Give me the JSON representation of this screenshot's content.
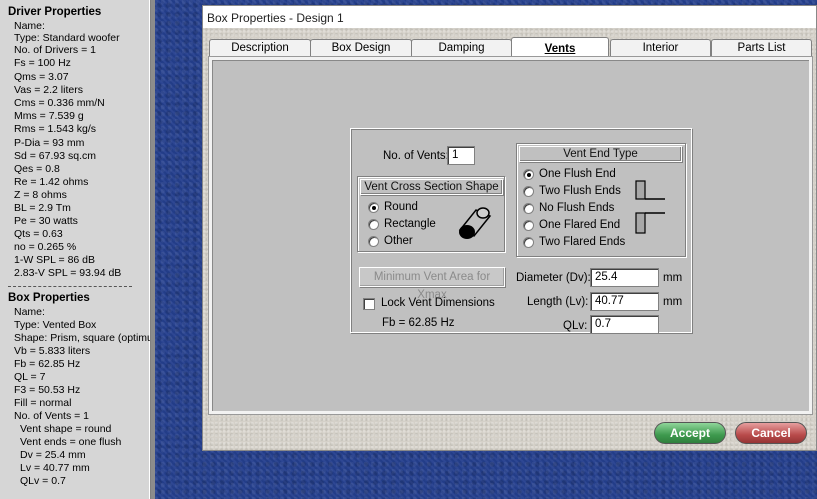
{
  "driver": {
    "title": "Driver Properties",
    "lines": [
      "Name:",
      "Type: Standard woofer",
      "No. of Drivers = 1",
      "Fs = 100 Hz",
      "Qms = 3.07",
      "Vas = 2.2 liters",
      "Cms = 0.336 mm/N",
      "Mms = 7.539 g",
      "Rms = 1.543 kg/s",
      "P-Dia = 93 mm",
      "Sd = 67.93 sq.cm",
      "Qes = 0.8",
      "Re = 1.42 ohms",
      "Z = 8 ohms",
      "BL = 2.9 Tm",
      "Pe = 30 watts",
      "Qts = 0.63",
      "no = 0.265 %",
      "1-W SPL = 86 dB",
      "2.83-V SPL = 93.94 dB"
    ]
  },
  "box": {
    "title": "Box Properties",
    "lines": [
      "Name:",
      "Type: Vented Box",
      "Shape: Prism, square (optimum)",
      "Vb = 5.833 liters",
      "Fb = 62.85 Hz",
      "QL = 7",
      "F3 = 50.53 Hz",
      "Fill = normal",
      "No. of Vents = 1"
    ],
    "sub_lines": [
      "Vent shape = round",
      "Vent ends = one flush",
      "Dv = 25.4 mm",
      "Lv = 40.77 mm",
      "QLv = 0.7"
    ]
  },
  "dialog": {
    "title": "Box Properties - Design 1",
    "tabs": [
      "Description",
      "Box Design",
      "Damping",
      "Vents",
      "Interior",
      "Parts List"
    ],
    "active_tab": "Vents",
    "accept_label": "Accept",
    "cancel_label": "Cancel",
    "accept_color": "#3e9a4e",
    "cancel_color": "#b84a4a"
  },
  "vents": {
    "num_vents_label": "No. of Vents:",
    "num_vents": "1",
    "cross_section_title": "Vent Cross Section Shape",
    "cross_section_options": [
      "Round",
      "Rectangle",
      "Other"
    ],
    "cross_section_selected": "Round",
    "end_type_title": "Vent End Type",
    "end_type_options": [
      "One Flush End",
      "Two Flush Ends",
      "No Flush Ends",
      "One Flared End",
      "Two Flared Ends"
    ],
    "end_type_selected": "One Flush End",
    "min_area_button": "Minimum Vent Area for Xmax",
    "lock_label": "Lock Vent Dimensions",
    "lock_checked": false,
    "fb_text": "Fb = 62.85 Hz",
    "diameter_label": "Diameter (Dv):",
    "diameter_value": "25.4",
    "diameter_unit": "mm",
    "length_label": "Length (Lv):",
    "length_value": "40.77",
    "length_unit": "mm",
    "qlv_label": "QLv:",
    "qlv_value": "0.7"
  }
}
